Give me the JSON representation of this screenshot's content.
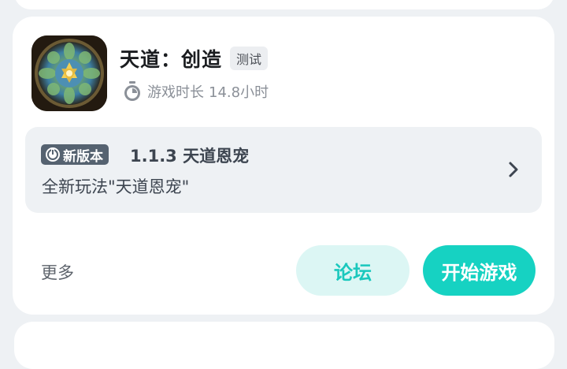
{
  "game": {
    "title": "天道：创造",
    "tag": "测试",
    "playtime_label": "游戏时长",
    "playtime_value": "14.8小时",
    "icon": "game-mandala-icon"
  },
  "update": {
    "badge_label": "新版本",
    "version": "1.1.3 天道恩宠",
    "description": "全新玩法\"天道恩宠\""
  },
  "actions": {
    "more_label": "更多",
    "forum_label": "论坛",
    "start_label": "开始游戏"
  },
  "colors": {
    "accent": "#16d2c2",
    "accent_light": "#dcf6f4",
    "badge": "#556270"
  }
}
